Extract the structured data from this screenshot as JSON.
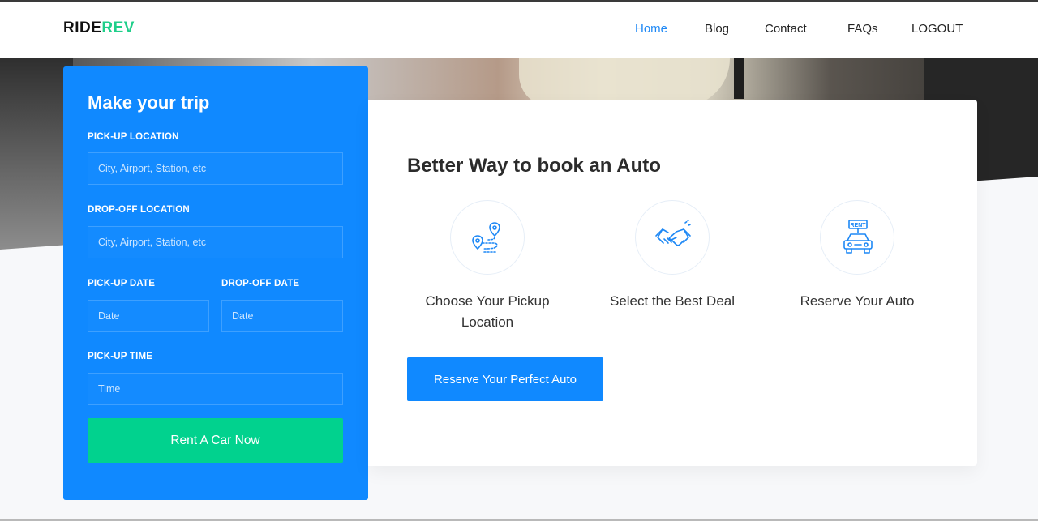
{
  "brand": {
    "part1": "RIDE",
    "part2": "REV",
    "accent": "#1fcf8a"
  },
  "nav": {
    "items": [
      {
        "label": "Home",
        "active": true
      },
      {
        "label": "Blog",
        "active": false
      },
      {
        "label": "Contact",
        "active": false
      },
      {
        "label": "FAQs",
        "active": false
      },
      {
        "label": "LOGOUT",
        "active": false
      }
    ]
  },
  "booking": {
    "title": "Make your trip",
    "pickup_location": {
      "label": "PICK-UP LOCATION",
      "placeholder": "City, Airport, Station, etc",
      "value": ""
    },
    "dropoff_location": {
      "label": "DROP-OFF LOCATION",
      "placeholder": "City, Airport, Station, etc",
      "value": ""
    },
    "pickup_date": {
      "label": "PICK-UP DATE",
      "placeholder": "Date",
      "value": ""
    },
    "dropoff_date": {
      "label": "DROP-OFF DATE",
      "placeholder": "Date",
      "value": ""
    },
    "pickup_time": {
      "label": "PICK-UP TIME",
      "placeholder": "Time",
      "value": ""
    },
    "submit_label": "Rent A Car Now",
    "panel_color": "#1089ff",
    "submit_color": "#01d28e"
  },
  "services": {
    "title": "Better Way to book an Auto",
    "items": [
      {
        "icon": "route-pin-icon",
        "label": "Choose Your Pickup Location"
      },
      {
        "icon": "handshake-icon",
        "label": "Select the Best Deal"
      },
      {
        "icon": "rent-car-icon",
        "label": "Reserve Your Auto"
      }
    ],
    "cta_label": "Reserve Your Perfect Auto",
    "icon_color": "#1e88f5"
  }
}
